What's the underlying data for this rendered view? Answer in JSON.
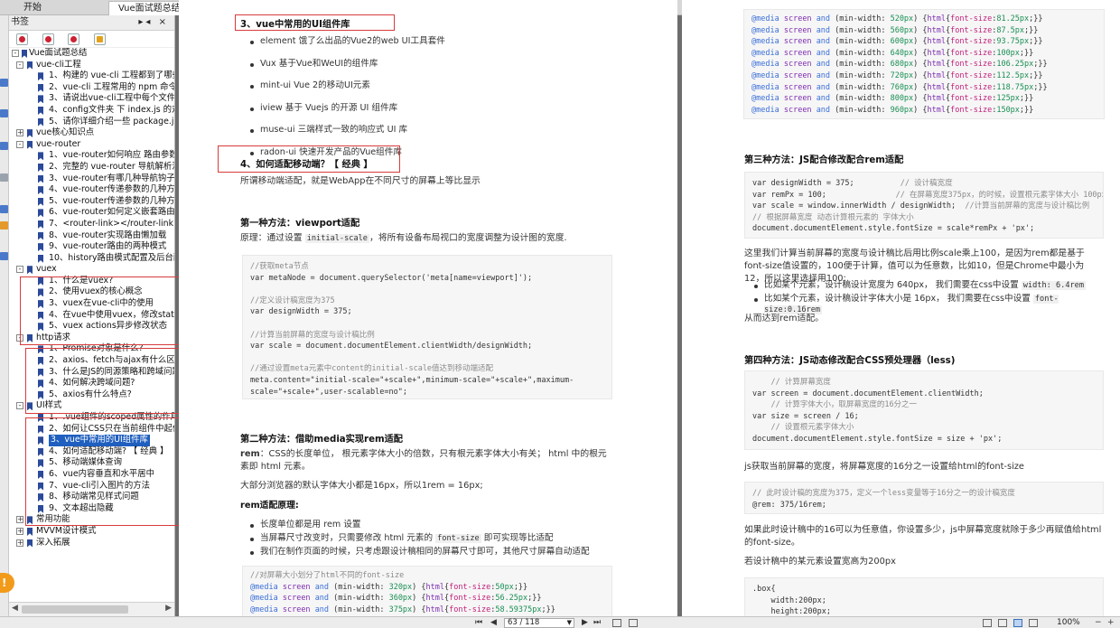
{
  "tabs": [
    {
      "label": "开始",
      "active": false
    },
    {
      "label": "Vue面试题总结.pdf *",
      "active": true,
      "close": "×"
    }
  ],
  "sidebar": {
    "title": "书签",
    "controls": "▸◂ ×",
    "tree": [
      {
        "level": 0,
        "exp": "-",
        "label": "Vue面试题总结"
      },
      {
        "level": 1,
        "exp": "-",
        "label": "vue-cli工程"
      },
      {
        "level": 2,
        "label": "1、构建的 vue-cli 工程都到了哪些技"
      },
      {
        "level": 2,
        "label": "2、vue-cli 工程常用的 npm 命令有"
      },
      {
        "level": 2,
        "label": "3、请说出vue-cli工程中每个文件夹"
      },
      {
        "level": 2,
        "label": "4、config文件夹 下 index.js 的对于"
      },
      {
        "level": 2,
        "label": "5、请你详细介绍一些 package.json"
      },
      {
        "level": 1,
        "exp": "+",
        "label": "vue核心知识点"
      },
      {
        "level": 1,
        "exp": "-",
        "label": "vue-router"
      },
      {
        "level": 2,
        "label": "1、vue-router如何响应 路由参数 的"
      },
      {
        "level": 2,
        "label": "2、完整的 vue-router 导航解析流程"
      },
      {
        "level": 2,
        "label": "3、vue-router有哪几种导航钩子（"
      },
      {
        "level": 2,
        "label": "4、vue-router传递参数的几种方式"
      },
      {
        "level": 2,
        "label": "5、vue-router传递参数的几种方式"
      },
      {
        "level": 2,
        "label": "6、vue-router如何定义嵌套路由？"
      },
      {
        "level": 2,
        "label": "7、<router-link></router-link>组件"
      },
      {
        "level": 2,
        "label": "8、vue-router实现路由懒加载"
      },
      {
        "level": 2,
        "label": "9、vue-router路由的两种模式"
      },
      {
        "level": 2,
        "label": "10、history路由模式配置及后台配置"
      },
      {
        "level": 1,
        "exp": "-",
        "label": "vuex"
      },
      {
        "level": 2,
        "label": "1、什么是vuex?"
      },
      {
        "level": 2,
        "label": "2、使用vuex的核心概念"
      },
      {
        "level": 2,
        "label": "3、vuex在vue-cli中的使用"
      },
      {
        "level": 2,
        "label": "4、在vue中使用vuex，修改state的"
      },
      {
        "level": 2,
        "label": "5、vuex actions异步修改状态"
      },
      {
        "level": 1,
        "exp": "-",
        "label": "http请求"
      },
      {
        "level": 2,
        "label": "1、Promise对象是什么?"
      },
      {
        "level": 2,
        "label": "2、axios、fetch与ajax有什么区别?"
      },
      {
        "level": 2,
        "label": "3、什么是JS的同源策略和跨域问题?"
      },
      {
        "level": 2,
        "label": "4、如何解决跨域问题?"
      },
      {
        "level": 2,
        "label": "5、axios有什么特点?"
      },
      {
        "level": 1,
        "exp": "-",
        "label": "UI样式"
      },
      {
        "level": 2,
        "label": "1、.vue组件的scoped属性的作用"
      },
      {
        "level": 2,
        "label": "2、如何让CSS只在当前组件中起作用"
      },
      {
        "level": 2,
        "label": "3、vue中常用的UI组件库",
        "selected": true
      },
      {
        "level": 2,
        "label": "4、如何适配移动端? 【 经典 】"
      },
      {
        "level": 2,
        "label": "5、移动端媒体查询"
      },
      {
        "level": 2,
        "label": "6、vue内容垂直和水平居中"
      },
      {
        "level": 2,
        "label": "7、vue-cli引入图片的方法"
      },
      {
        "level": 2,
        "label": "8、移动端常见样式问题"
      },
      {
        "level": 2,
        "label": "9、文本超出隐藏"
      },
      {
        "level": 1,
        "exp": "+",
        "label": "常用功能"
      },
      {
        "level": 1,
        "exp": "+",
        "label": "MVVM设计模式"
      },
      {
        "level": 1,
        "exp": "+",
        "label": "深入拓展"
      }
    ]
  },
  "page1": {
    "sec3_title": "3、vue中常用的UI组件库",
    "sec3_items": [
      "element 饿了么出品的Vue2的web UI工具套件",
      "Vux 基于Vue和WeUI的组件库",
      "mint-ui Vue 2的移动UI元素",
      "iview 基于 Vuejs 的开源 UI 组件库",
      "muse-ui 三端样式一致的响应式 UI 库",
      "radon-ui 快速开发产品的Vue组件库"
    ],
    "sec4_title": "4、如何适配移动端？【 经典 】",
    "sec4_desc": "所谓移动端适配，就是WebApp在不同尺寸的屏幕上等比显示",
    "m1_title": "第一种方法：viewport适配",
    "m1_desc_pre": "原理：通过设置",
    "m1_desc_code": "initial-scale",
    "m1_desc_post": "，将所有设备布局视口的宽度调整为设计图的宽度.",
    "m1_code": [
      "//获取meta节点",
      "var metaNode = document.querySelector('meta[name=viewport]');",
      "",
      "//定义设计稿宽度为375",
      "var designWidth = 375;",
      "",
      "//计算当前屏幕的宽度与设计稿比例",
      "var scale = document.documentElement.clientWidth/designWidth;",
      "",
      "//通过设置meta元素中content的initial-scale值达到移动端适配",
      "meta.content=\"initial-scale=\"+scale+\",minimum-scale=\"+scale+\",maximum-",
      "scale=\"+scale+\",user-scalable=no\";"
    ],
    "m2_title": "第二种方法：借助media实现rem适配",
    "m2_rem_label": "rem",
    "m2_rem_desc": "：CSS的长度单位，  根元素字体大小的倍数，只有根元素字体大小有关；  html 中的根元素即 html 元素。",
    "m2_default": "大部分浏览器的默认字体大小都是16px，所以1rem = 16px;",
    "m2_principle": "rem适配原理:",
    "m2_items": [
      "长度单位都是用 rem 设置",
      "当屏幕尺寸改变时，只需要修改 html 元素的 font-size 即可实现等比适配",
      "我们在制作页面的时候，只考虑跟设计稿相同的屏幕尺寸即可，其他尺寸屏幕自动适配"
    ],
    "m2_item2_pre": "当屏幕尺寸改变时，只需要修改 html 元素的",
    "m2_item2_code": "font-size",
    "m2_item2_post": "即可实现等比适配",
    "m2_code_comment": "//对屏幕大小划分了html不同的font-size",
    "media_rows": [
      [
        "320px",
        "50px"
      ],
      [
        "360px",
        "56.25px"
      ],
      [
        "375px",
        "58.59375px"
      ]
    ]
  },
  "page2": {
    "media_rows": [
      [
        "520px",
        "81.25px"
      ],
      [
        "560px",
        "87.5px"
      ],
      [
        "600px",
        "93.75px"
      ],
      [
        "640px",
        "100px"
      ],
      [
        "680px",
        "106.25px"
      ],
      [
        "720px",
        "112.5px"
      ],
      [
        "760px",
        "118.75px"
      ],
      [
        "800px",
        "125px"
      ],
      [
        "960px",
        "150px"
      ]
    ],
    "m3_title": "第三种方法：JS配合修改配合rem适配",
    "m3_code": [
      "var designWidth = 375;          // 设计稿宽度",
      "var remPx = 100;               // 在屏幕宽度375px，的时候，设置根元素字体大小 100px",
      "var scale = window.innerWidth / designWidth;  //计算当前屏幕的宽度与设计稿比例",
      "// 根据屏幕宽度 动态计算根元素的 字体大小",
      "document.documentElement.style.fontSize = scale*remPx + 'px';"
    ],
    "m3_explain": "这里我们计算当前屏幕的宽度与设计稿比后用比例scale乘上100，是因为rem都是基于font-size值设置的，100便于计算，值可以为任意数，比如10，但是Chrome中最小为12，所以这里选择用100;",
    "m3_items_pre": [
      "比如某个元素，设计稿设计宽度为 640px， 我们需要在css中设置",
      "比如某个元素，设计稿设计字体大小是 16px， 我们需要在css中设置"
    ],
    "m3_items_code": [
      "width: 6.4rem",
      "font-size:0.16rem"
    ],
    "m3_result": "从而达到rem适配。",
    "m4_title": "第四种方法：JS动态修改配合CSS预处理器（less)",
    "m4_code": [
      "    // 计算屏幕宽度",
      "var screen = document.documentElement.clientWidth;",
      "    // 计算字体大小，取屏幕宽度的16分之一",
      "var size = screen / 16;",
      "    // 设置根元素字体大小",
      "document.documentElement.style.fontSize = size + 'px';"
    ],
    "m4_desc": "js获取当前屏幕的宽度，将屏幕宽度的16分之一设置给html的font-size",
    "m4_code2": [
      "// 此时设计稿的宽度为375，定义一个less变量等于16分之一的设计稿宽度",
      "@rem: 375/16rem;"
    ],
    "m4_desc2": "如果此时设计稿中的16可以为任意值，你设置多少，js中屏幕宽度就除于多少再赋值给html的font-size。",
    "m4_desc3": "若设计稿中的某元素设置宽高为200px",
    "m4_code3": [
      ".box{",
      "    width:200px;",
      "    height:200px;"
    ]
  },
  "statusbar": {
    "page_display": "63 / 118",
    "zoom": "100%"
  },
  "colors": {
    "selection": "#1f5fbf",
    "annotation_red": "#d83b3b",
    "code_keyword": "#7d2db0",
    "code_blue": "#3a6fd8",
    "code_string": "#c21f7a",
    "code_green": "#1a8f54"
  }
}
